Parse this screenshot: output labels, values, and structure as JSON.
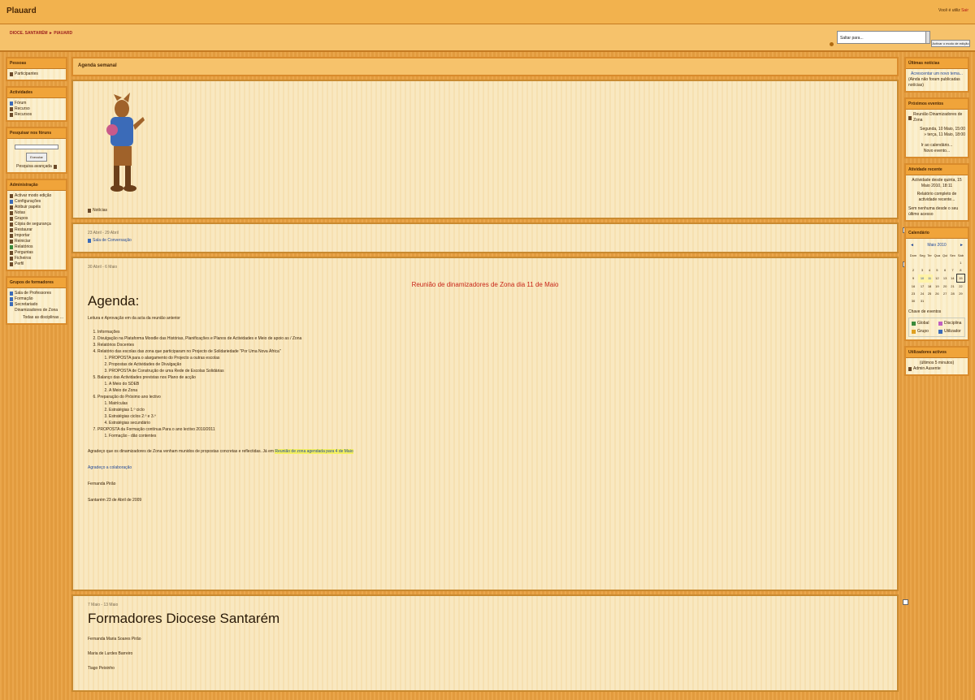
{
  "header": {
    "title": "Plauard",
    "login": {
      "text": "Você é utiliz",
      "link": "Sair"
    }
  },
  "nav": {
    "breadcrumb": "DIOCE. SANTARÉM ► PIAUARD",
    "jump_value": "Saltar para...",
    "edit_button": "Activar o modo de edição"
  },
  "left": {
    "people": {
      "title": "Pessoas",
      "items": [
        "Participantes"
      ]
    },
    "activities": {
      "title": "Actividades",
      "items": [
        "Fórum",
        "Recurso",
        "Recursos"
      ]
    },
    "search": {
      "title": "Pesquisar nos fóruns",
      "button": "Executar",
      "advanced": "Pesquisa avançada"
    },
    "admin": {
      "title": "Administração",
      "items": [
        "Activar modo edição",
        "Configurações",
        "Atribuir papéis",
        "Notas",
        "Grupos",
        "Cópia de segurança",
        "Restaurar",
        "Importar",
        "Reiniciar",
        "Relatórios",
        "Perguntas",
        "Ficheiros",
        "Perfil"
      ]
    },
    "groups": {
      "title": "Grupos de formadores",
      "items": [
        "Sala de Professores",
        "Formação",
        "Secretariado Dinamizadores de Zona"
      ],
      "more": "Todas as disciplinas ..."
    }
  },
  "main": {
    "heading": "Agenda semanal",
    "news": "Notícias",
    "week1": {
      "date": "23 Abril - 29 Abril",
      "forum": "Sala de Conversação"
    },
    "week2": {
      "date": "30 Abril - 6 Maio",
      "red_title": "Reunião de dinamizadores de Zona dia 11 de Maio",
      "heading": "Agenda:",
      "intro": "Leitura e Aprovação em da acta da reunião anterior",
      "list": [
        {
          "text": "Informações",
          "sub": []
        },
        {
          "text": "Divulgação na Plataforma Moodle das Histórias, Planificações e Planos de Actividades e Meio de apoio as / Zona",
          "sub": []
        },
        {
          "text": "Relatórios Docentes",
          "sub": []
        },
        {
          "text": "Relatório das escolas das zona que participaram no Projecto de Solidariedade \"Por Uma Nova África\"",
          "sub": [
            "PROPOSTA para o alargamento do Projecto a outras escolas",
            "Propostas de Actividades de Divulgação",
            "PROPOSTA de Construção de uma Rede de Escolas Solidárias"
          ]
        },
        {
          "text": "Balanço das Actividades previstas nos Plano de acção",
          "sub": [
            "A Meio do SDEB",
            "A Meio de Zona"
          ]
        },
        {
          "text": "Preparação do Próximo ano lectivo",
          "sub": [
            "Matrículas",
            "Estratégias 1.º ciclo",
            "Estratégias ciclos 2.º e 3.º",
            "Estratégias secundário"
          ]
        },
        {
          "text": "PROPOSTA da Formação contínua Para o ano lectivo 2010/2011",
          "sub": [
            "Formação - dão contentes"
          ]
        }
      ],
      "closing": "Agradeço que os dinamizadores de Zona venham munidos de propostas concretas e reflectidas. Já em",
      "closing_link": "Reunião de zona agendada para 4 de Maio",
      "thanks": "Agradeço a colaboração",
      "signature": "Fernanda Pirão",
      "place_date": "Santarém 23 de Abril de 2009"
    },
    "week3": {
      "date": "7 Maio - 13 Maio",
      "heading": "Formadores Diocese Santarém",
      "names": [
        "Fernanda Maria Soares Pirão",
        "Maria de Lurdes Barreiro",
        "Tiago Peixinho"
      ]
    }
  },
  "right": {
    "news": {
      "title": "Últimas notícias",
      "add": "Acrescentar um novo tema...",
      "empty": "(Ainda não foram publicadas notícias)"
    },
    "upcoming": {
      "title": "Próximos eventos",
      "event": "Reunião Dinamizadores de Zona",
      "dates": [
        "Segunda, 10 Maio, 15:00",
        "» terça, 11 Maio, 18:00"
      ],
      "calendar": "Ir ao calendário...",
      "new_event": "Novo evento..."
    },
    "recent": {
      "title": "Atividade recente",
      "since": "Actividade desde quinta, 15 Maio 2010, 18:11",
      "report": "Relatório completo de actividade recente...",
      "none": "Sem nenhuma desde o seu último acesso"
    },
    "calendar": {
      "title": "Calendário",
      "month": "Maio 2010",
      "days": [
        "Dom",
        "Seg",
        "Ter",
        "Qua",
        "Qui",
        "Sex",
        "Sáb"
      ],
      "weeks": [
        [
          "",
          "",
          "",
          "",
          "",
          "",
          "1"
        ],
        [
          "2",
          "3",
          "4",
          "5",
          "6",
          "7",
          "8"
        ],
        [
          "9",
          "10",
          "11",
          "12",
          "13",
          "14",
          "15"
        ],
        [
          "16",
          "17",
          "18",
          "19",
          "20",
          "21",
          "22"
        ],
        [
          "23",
          "24",
          "25",
          "26",
          "27",
          "28",
          "29"
        ],
        [
          "30",
          "31",
          "",
          "",
          "",
          "",
          ""
        ]
      ],
      "key_title": "Chave de eventos",
      "key": [
        "Global",
        "Disciplina",
        "Grupo",
        "Utilizador"
      ],
      "key_colors": [
        "#3a8a3a",
        "#c060c0",
        "#e0a020",
        "#3b6bb8"
      ]
    },
    "online": {
      "title": "Utilizadores activos",
      "text": "(últimos 5 minutos)",
      "user": "Admin Ausente"
    }
  }
}
